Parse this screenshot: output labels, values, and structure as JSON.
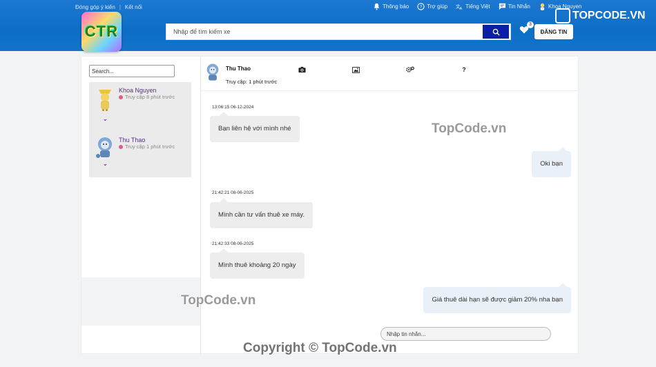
{
  "header": {
    "links": [
      "Đóng góp ý kiến",
      "Kết nối"
    ],
    "right_links": [
      {
        "label": "Thông báo",
        "icon": "bell-icon"
      },
      {
        "label": "Trợ giúp",
        "icon": "help-icon"
      },
      {
        "label": "Tiếng Việt",
        "icon": "translate-icon"
      },
      {
        "label": "Tin Nhắn",
        "icon": "message-icon"
      },
      {
        "label": "Khoa Nguyen",
        "icon": "user-avatar-icon"
      }
    ],
    "logo_text": "CTR",
    "search_placeholder": "Nhập để tìm kiếm xe",
    "favorites_count": "3",
    "post_button": "ĐĂNG TIN"
  },
  "sidebar": {
    "search_placeholder": "Search...",
    "users": [
      {
        "name": "Khoa Nguyen",
        "status": "Truy cập 8 phút trước"
      },
      {
        "name": "Thu Thao",
        "status": "Truy cập 1 phút trước"
      }
    ]
  },
  "chat": {
    "contact_name": "Thu Thao",
    "contact_status": "Truy cập: 1 phút trước",
    "messages": [
      {
        "time": "13:06:15 06-12-2024",
        "text": "Bạn liên hệ với mình nhé",
        "side": "left"
      },
      {
        "time": "",
        "text": "Oki bạn",
        "side": "right"
      },
      {
        "time": "21:42:21 08-06-2025",
        "text": "Mình cần tư vấn thuê xe máy.",
        "side": "left"
      },
      {
        "time": "21:42:33 08-06-2025",
        "text": "Mình thuê khoảng 20 ngày",
        "side": "left"
      },
      {
        "time": "",
        "text": "Giá thuê dài hạn sẽ được giảm 20% nha bạn",
        "side": "right"
      }
    ],
    "input_placeholder": "Nhập tin nhắn..."
  },
  "watermarks": {
    "brand": "TOPCODE.VN",
    "text": "TopCode.vn",
    "copyright": "Copyright © TopCode.vn"
  },
  "colors": {
    "header_blue": "#0d6ec6",
    "search_button": "#0a1fa6",
    "user_name": "#5a2d8c"
  }
}
